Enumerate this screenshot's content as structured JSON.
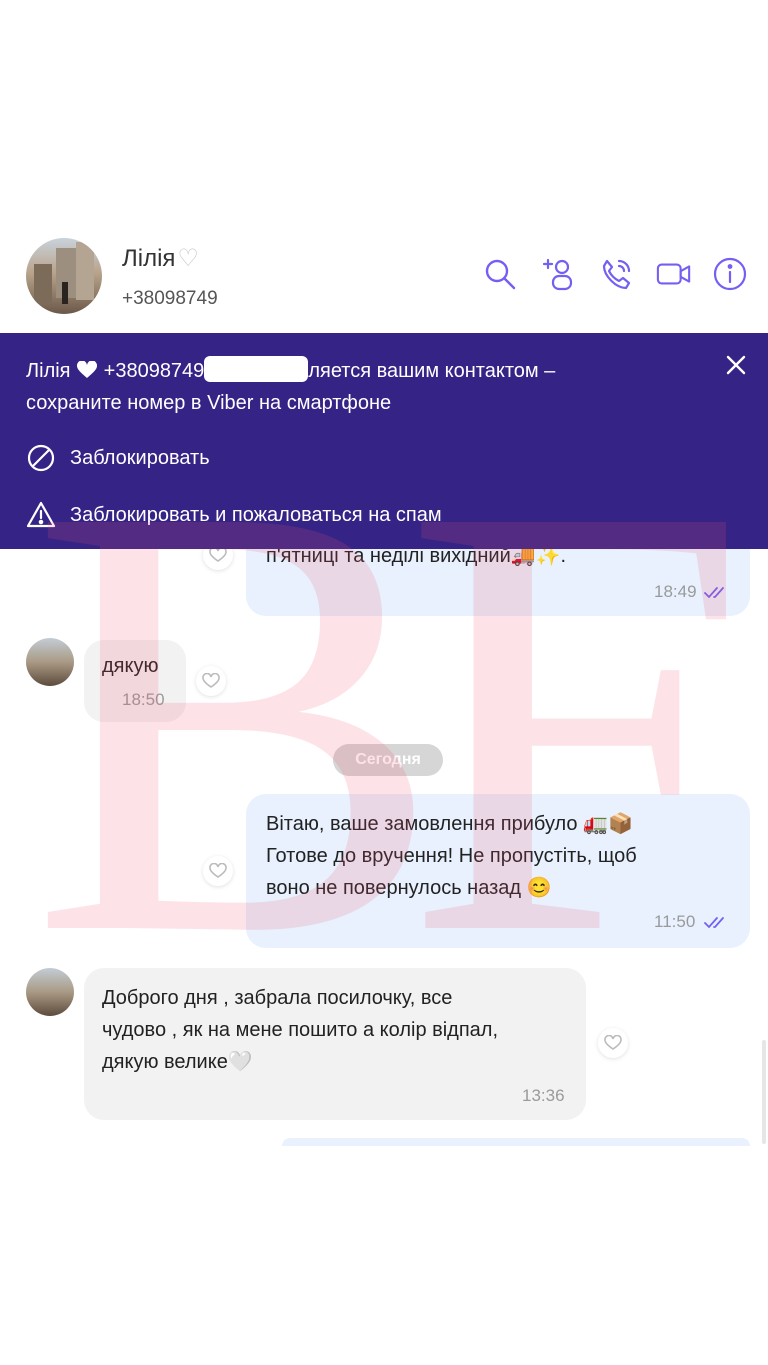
{
  "header": {
    "contact_name": "Лілія",
    "name_heart": "♡",
    "contact_phone": "+38098749"
  },
  "icons": {
    "search": "search-icon",
    "add_participant": "add-user-icon",
    "call": "phone-icon",
    "video": "video-icon",
    "info": "info-icon"
  },
  "banner": {
    "line1_name": "Лілія",
    "line1_phone": "+38098749",
    "line1_rest": "ляется вашим контактом –",
    "line2": "сохраните номер в Viber на смартфоне",
    "block_label": "Заблокировать",
    "block_spam_label": "Заблокировать и пожаловаться на спам",
    "bg_color": "#352486"
  },
  "messages": [
    {
      "direction": "out",
      "text": "п'ятниці та неділі вихідний🚚✨.",
      "time": "18:49",
      "read": true
    },
    {
      "direction": "in",
      "text": "дякую",
      "time": "18:50"
    },
    {
      "direction": "out",
      "text": "Вітаю, ваше замовлення прибуло 🚛📦\nГотове до вручення! Не пропустіть, щоб\nвоно не повернулось назад 😊",
      "time": "11:50",
      "read": true
    },
    {
      "direction": "in",
      "text": "Доброго дня , забрала посилочку, все\nчудово , як на мене пошито а колір відпал,\nдякую велике🤍",
      "time": "13:36"
    }
  ],
  "date_separator": "Сегодня",
  "watermark": "BF",
  "colors": {
    "accent": "#7360f2",
    "outgoing_bubble": "#e8f1fd",
    "incoming_bubble": "#f2f2f2"
  }
}
